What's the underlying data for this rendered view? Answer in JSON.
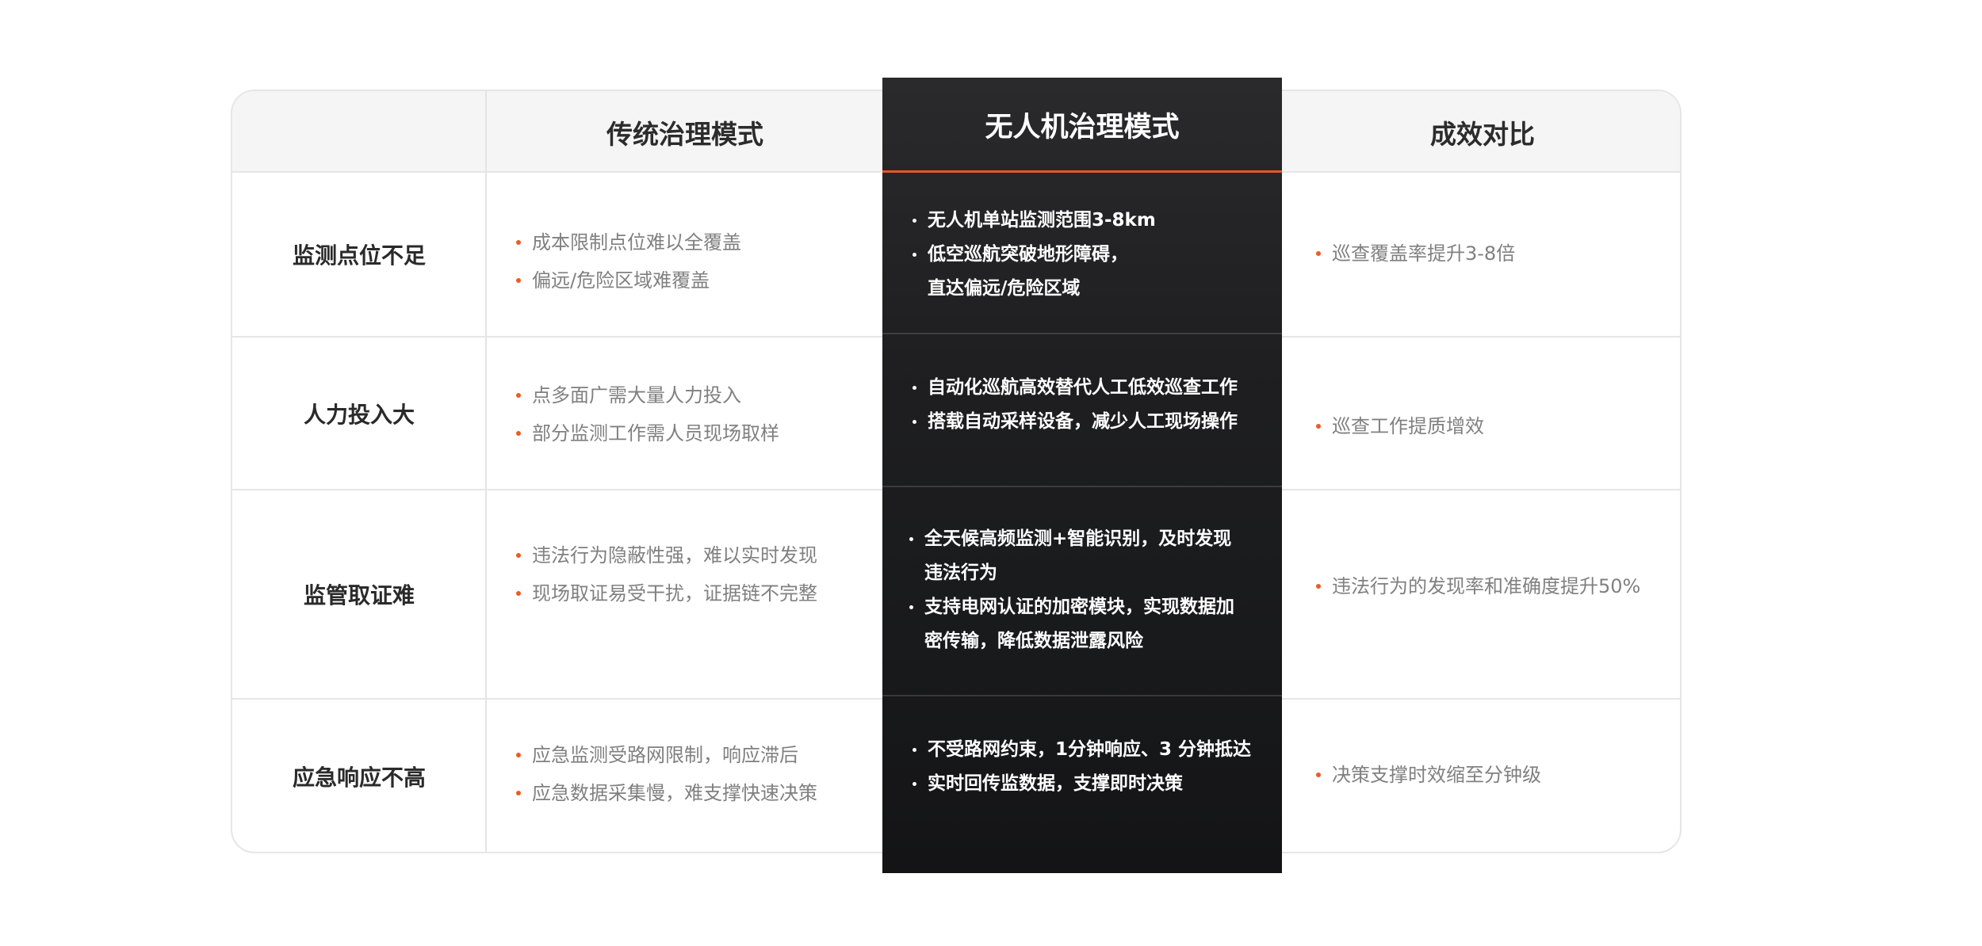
{
  "columns": {
    "traditional": "传统治理模式",
    "drone": "无人机治理模式",
    "effect": "成效对比"
  },
  "rows": [
    {
      "label": "监测点位不足",
      "traditional": [
        "成本限制点位难以全覆盖",
        "偏远/危险区域难覆盖"
      ],
      "drone": [
        "无人机单站监测范围3-8km",
        "低空巡航突破地形障碍，\n直达偏远/危险区域"
      ],
      "effect": [
        "巡查覆盖率提升3-8倍"
      ]
    },
    {
      "label": "人力投入大",
      "traditional": [
        "点多面广需大量人力投入",
        "部分监测工作需人员现场取样"
      ],
      "drone": [
        "自动化巡航高效替代人工低效巡查工作",
        "搭载自动采样设备，减少人工现场操作"
      ],
      "effect": [
        "巡查工作提质增效"
      ]
    },
    {
      "label": "监管取证难",
      "traditional": [
        "违法行为隐蔽性强，难以实时发现",
        "现场取证易受干扰，证据链不完整"
      ],
      "drone": [
        "全天候高频监测+智能识别，及时发现\n违法行为",
        "支持电网认证的加密模块，实现数据加\n密传输，降低数据泄露风险"
      ],
      "effect": [
        "违法行为的发现率和准确度提升50%"
      ]
    },
    {
      "label": "应急响应不高",
      "traditional": [
        "应急监测受路网限制，响应滞后",
        "应急数据采集慢，难支撑快速决策"
      ],
      "drone": [
        "不受路网约束，1分钟响应、3 分钟抵达",
        "实时回传监数据，支撑即时决策"
      ],
      "effect": [
        "决策支撑时效缩至分钟级"
      ]
    }
  ],
  "colors": {
    "accent": "#ee5a24",
    "dark_column": "#1c1c1e",
    "header_bg": "#f5f5f5"
  }
}
